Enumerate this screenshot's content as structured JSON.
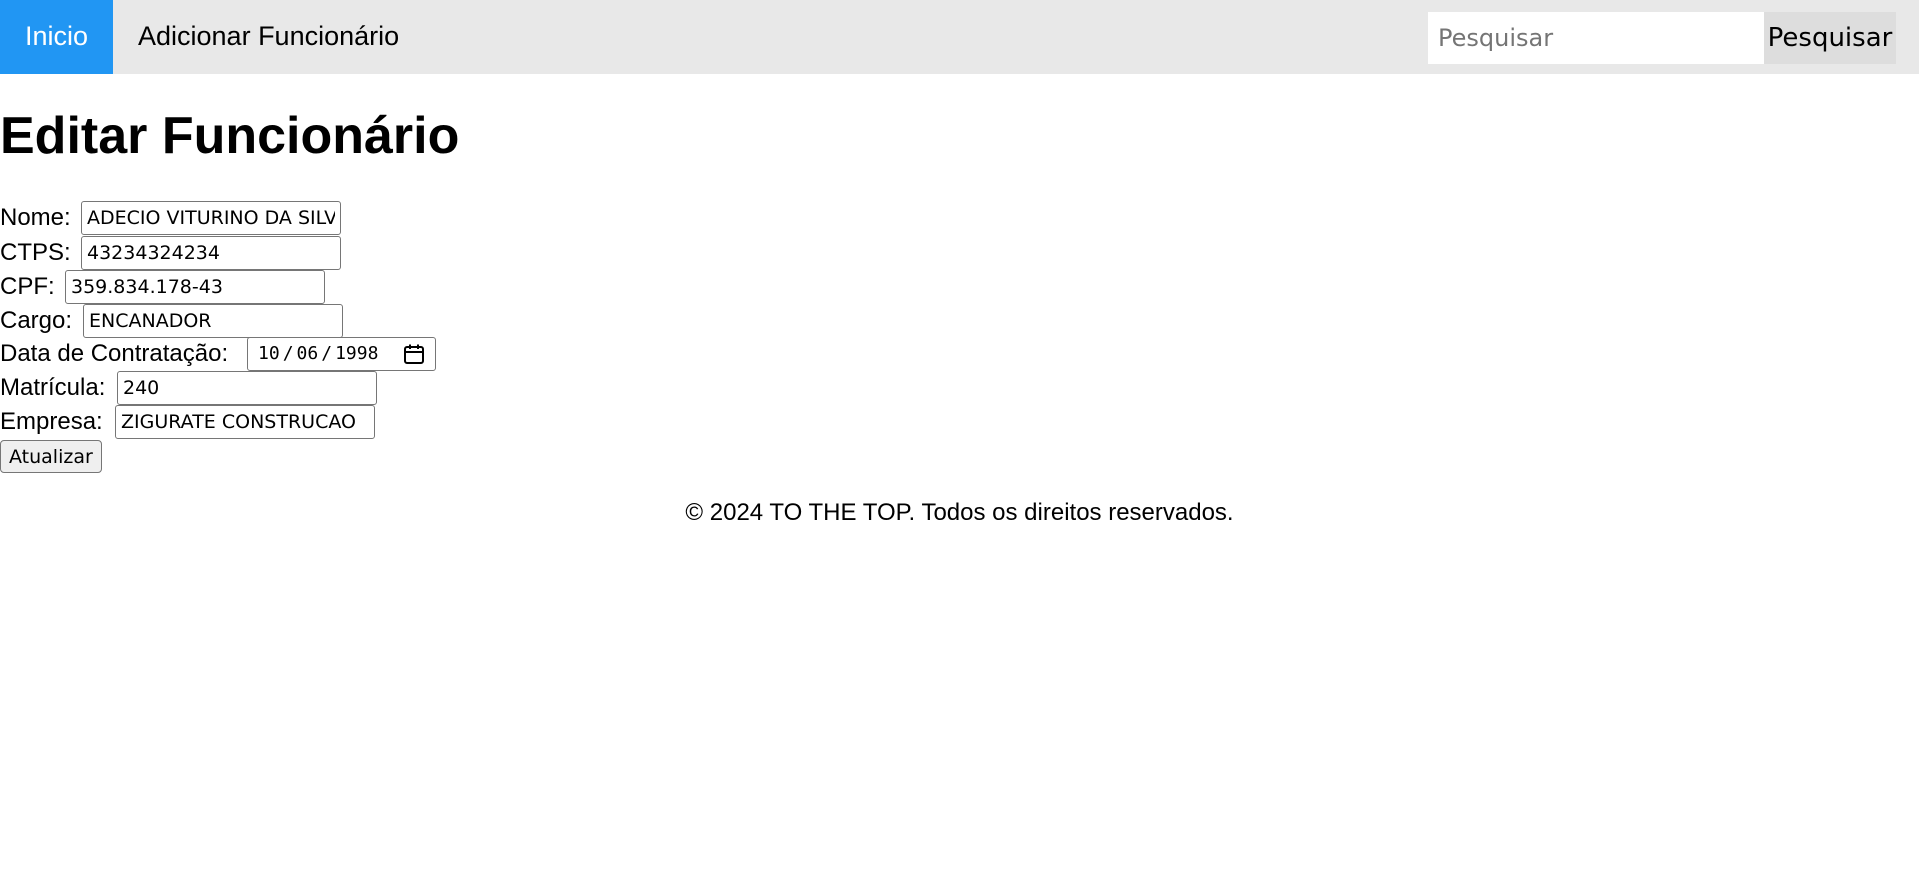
{
  "nav": {
    "home_label": "Inicio",
    "add_label": "Adicionar Funcionário",
    "search_placeholder": "Pesquisar",
    "search_value": "",
    "search_button_label": "Pesquisar",
    "active_color": "#2196f3"
  },
  "page": {
    "title": "Editar Funcionário"
  },
  "form": {
    "nome": {
      "label": "Nome:",
      "value": "ADECIO VITURINO DA SILVA"
    },
    "ctps": {
      "label": "CTPS:",
      "value": "43234324234"
    },
    "cpf": {
      "label": "CPF:",
      "value": "359.834.178-43"
    },
    "cargo": {
      "label": "Cargo:",
      "value": "ENCANADOR"
    },
    "data_contratacao": {
      "label": "Data de Contratação:",
      "day": "10",
      "month": "06",
      "year": "1998"
    },
    "matricula": {
      "label": "Matrícula:",
      "value": "240"
    },
    "empresa": {
      "label": "Empresa:",
      "value": "ZIGURATE CONSTRUCAO"
    },
    "submit_label": "Atualizar"
  },
  "footer": {
    "text": "© 2024 TO THE TOP. Todos os direitos reservados."
  }
}
